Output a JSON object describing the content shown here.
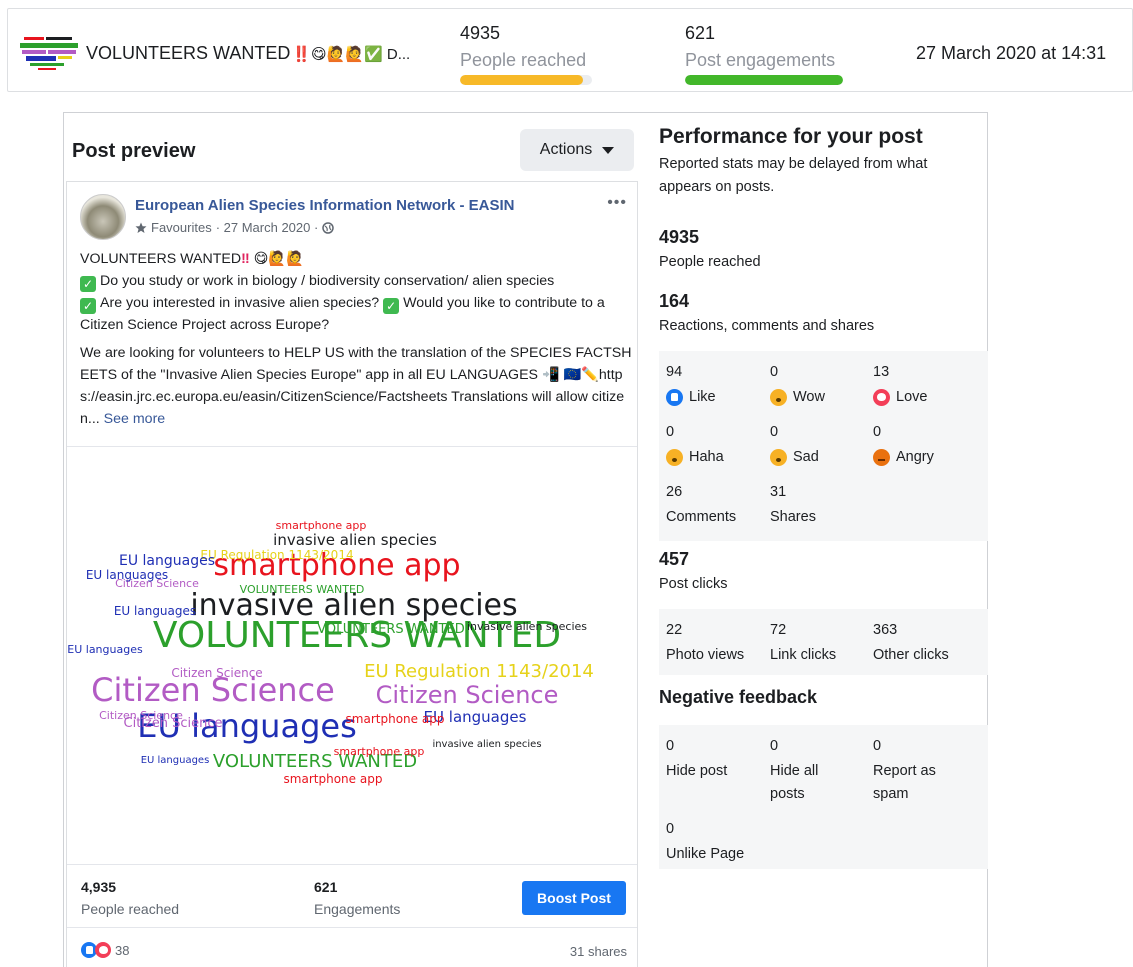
{
  "summary": {
    "post_title": "VOLUNTEERS WANTED",
    "post_title_emoji": "‼️😋🙋🙋✅ D...",
    "reached_value": "4935",
    "reached_label": "People reached",
    "reached_fraction": 0.93,
    "reached_color": "#f7b928",
    "engagement_value": "621",
    "engagement_label": "Post engagements",
    "engagement_fraction": 1.0,
    "engagement_color": "#42b72a",
    "date": "27 March 2020 at 14:31"
  },
  "preview": {
    "title": "Post preview",
    "actions_label": "Actions",
    "page_name": "European Alien Species Information Network - EASIN",
    "meta_fav": "Favourites",
    "meta_date": "· 27 March 2020 ·",
    "more_label": "•••",
    "body_line1": "VOLUNTEERS WANTED",
    "body_line1_emoji": "😋🙋🙋",
    "body_line2": "Do you study or work in biology / biodiversity conservation/ alien species",
    "body_line3a": "Are you interested in invasive alien species?",
    "body_line3b": "Would you like to contribute to a Citizen Science Project across Europe?",
    "body_para2": "We are looking for volunteers to HELP US with the translation of the SPECIES FACTSHEETS of the \"Invasive Alien Species Europe\" app in all EU LANGUAGES",
    "body_para2_emoji": "📲 🇪🇺✏️",
    "body_para2_tail": "https://easin.jrc.ec.europa.eu/easin/CitizenScience/Factsheets Translations will allow citizen...",
    "see_more": "See more",
    "reached_value": "4,935",
    "reached_label": "People reached",
    "engagement_value": "621",
    "engagement_label": "Engagements",
    "boost_label": "Boost Post",
    "reaction_count": "38",
    "shares_label": "31 shares"
  },
  "wordcloud": [
    {
      "text": "VOLUNTEERS WANTED",
      "color": "#2ca02c",
      "size": 36
    },
    {
      "text": "invasive alien species",
      "color": "#1c1e21",
      "size": 30
    },
    {
      "text": "smartphone app",
      "color": "#e8141e",
      "size": 30
    },
    {
      "text": "EU languages",
      "color": "#1f2fb4",
      "size": 32
    },
    {
      "text": "Citizen Science",
      "color": "#b25bc4",
      "size": 32
    },
    {
      "text": "Citizen Science",
      "color": "#b25bc4",
      "size": 24
    },
    {
      "text": "EU Regulation 1143/2014",
      "color": "#e6d21a",
      "size": 18
    },
    {
      "text": "invasive alien species",
      "color": "#1c1e21",
      "size": 15
    },
    {
      "text": "VOLUNTEERS WANTED",
      "color": "#2ca02c",
      "size": 18
    },
    {
      "text": "EU languages",
      "color": "#1f2fb4",
      "size": 15
    },
    {
      "text": "smartphone app",
      "color": "#e8141e",
      "size": 12
    },
    {
      "text": "Citizen Science",
      "color": "#b25bc4",
      "size": 12
    },
    {
      "text": "EU Regulation 1143/2014",
      "color": "#e6d21a",
      "size": 12
    },
    {
      "text": "EU languages",
      "color": "#1f2fb4",
      "size": 12
    },
    {
      "text": "smartphone app",
      "color": "#e8141e",
      "size": 11
    },
    {
      "text": "Citizen Science",
      "color": "#b25bc4",
      "size": 11
    },
    {
      "text": "VOLUNTEERS WANTED",
      "color": "#2ca02c",
      "size": 11
    },
    {
      "text": "EU languages",
      "color": "#1f2fb4",
      "size": 12
    },
    {
      "text": "Citizen Science",
      "color": "#b25bc4",
      "size": 13
    },
    {
      "text": "smartphone app",
      "color": "#e8141e",
      "size": 12
    },
    {
      "text": "VOLUNTEERS WANTED",
      "color": "#2ca02c",
      "size": 13
    },
    {
      "text": "EU languages",
      "color": "#1f2fb4",
      "size": 14
    },
    {
      "text": "invasive alien species",
      "color": "#1c1e21",
      "size": 11
    },
    {
      "text": "EU languages",
      "color": "#1f2fb4",
      "size": 11
    },
    {
      "text": "Citizen Science",
      "color": "#b25bc4",
      "size": 11
    },
    {
      "text": "smartphone app",
      "color": "#e8141e",
      "size": 11
    },
    {
      "text": "invasive alien species",
      "color": "#1c1e21",
      "size": 10
    },
    {
      "text": "EU languages",
      "color": "#1f2fb4",
      "size": 10
    }
  ],
  "performance": {
    "title": "Performance for your post",
    "subtitle": "Reported stats may be delayed from what appears on posts.",
    "reached_value": "4935",
    "reached_label": "People reached",
    "reactions_value": "164",
    "reactions_label": "Reactions, comments and shares",
    "reactions": [
      {
        "value": "94",
        "label": "Like",
        "icon": "like-icon"
      },
      {
        "value": "0",
        "label": "Wow",
        "icon": "wow-icon"
      },
      {
        "value": "13",
        "label": "Love",
        "icon": "love-icon"
      },
      {
        "value": "0",
        "label": "Haha",
        "icon": "haha-icon"
      },
      {
        "value": "0",
        "label": "Sad",
        "icon": "sad-icon"
      },
      {
        "value": "0",
        "label": "Angry",
        "icon": "angry-icon"
      },
      {
        "value": "26",
        "label": "Comments"
      },
      {
        "value": "31",
        "label": "Shares"
      }
    ],
    "clicks_value": "457",
    "clicks_label": "Post clicks",
    "clicks": [
      {
        "value": "22",
        "label": "Photo views"
      },
      {
        "value": "72",
        "label": "Link clicks"
      },
      {
        "value": "363",
        "label": "Other clicks"
      }
    ],
    "negative_title": "Negative feedback",
    "negative": [
      {
        "value": "0",
        "label": "Hide post"
      },
      {
        "value": "0",
        "label": "Hide all posts"
      },
      {
        "value": "0",
        "label": "Report as spam"
      },
      {
        "value": "0",
        "label": "Unlike Page"
      }
    ]
  }
}
